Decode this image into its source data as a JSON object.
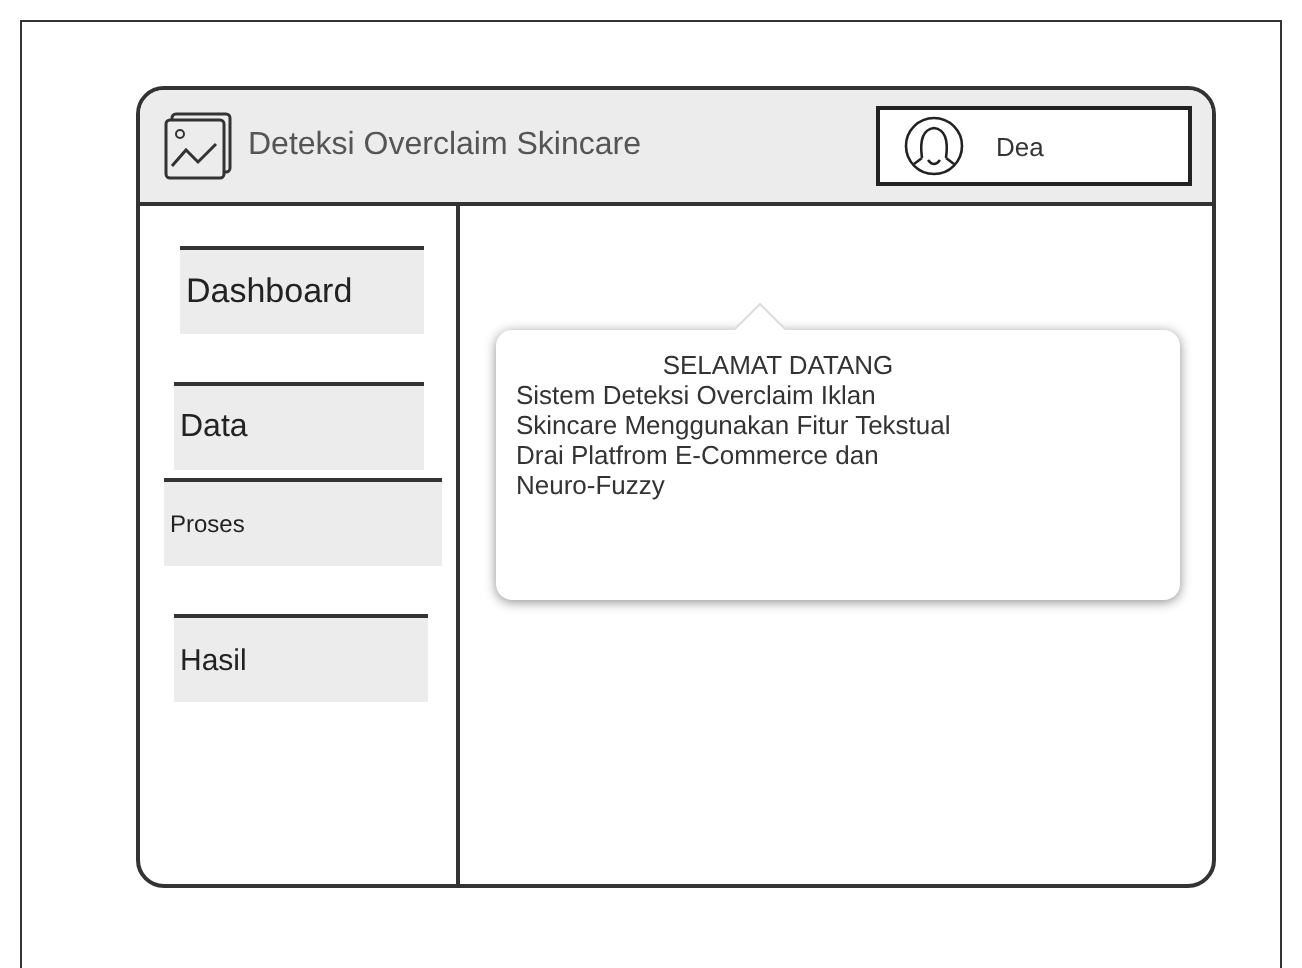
{
  "window": {
    "title": "Deteksi Overclaim Skincare"
  },
  "user": {
    "name": "Dea"
  },
  "sidebar": {
    "items": [
      {
        "label": "Dashboard"
      },
      {
        "label": "Data"
      },
      {
        "label": "Proses"
      },
      {
        "label": "Hasil"
      }
    ]
  },
  "welcome": {
    "heading": "SELAMAT DATANG",
    "message": "Sistem Deteksi Overclaim Iklan\nSkincare Menggunakan Fitur Tekstual\nDrai Platfrom E-Commerce dan\nNeuro-Fuzzy"
  }
}
